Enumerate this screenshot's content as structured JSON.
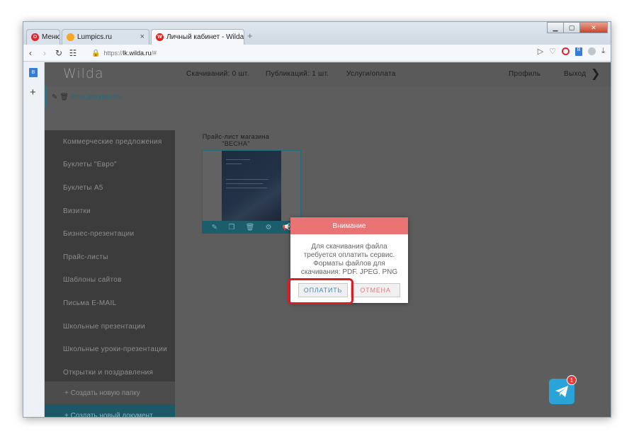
{
  "browser": {
    "tabs": [
      {
        "label": "Меню"
      },
      {
        "label": "Lumpics.ru"
      },
      {
        "label": "Личный кабинет - Wilda"
      }
    ],
    "new_tab_symbol": "+",
    "url": {
      "scheme": "https://",
      "host": "lk.wilda.ru",
      "path": "/#"
    },
    "nav_icons": [
      "back-icon",
      "forward-icon",
      "reload-icon",
      "grid-icon"
    ],
    "window_controls": [
      "minimize-icon",
      "maximize-icon",
      "close-icon"
    ]
  },
  "header": {
    "logo": "Wilda",
    "downloads": "Скачиваний: 0 шт.",
    "publications": "Публикаций: 1 шт.",
    "services": "Услуги/оплата",
    "profile": "Профиль",
    "exit": "Выход"
  },
  "sidebar": {
    "title": "Мои документы",
    "categories": [
      "Коммерческие предложения",
      "Буклеты \"Евро\"",
      "Буклеты А5",
      "Визитки",
      "Бизнес-презентации",
      "Прайс-листы",
      "Шаблоны сайтов",
      "Письма E-MAIL",
      "Школьные презентации",
      "Школьные уроки-презентации",
      "Открытки и поздравления"
    ],
    "new_folder": "+ Создать новую папку",
    "new_document": "+ Создать новый документ"
  },
  "document": {
    "title_line1": "Прайс-лист магазина",
    "title_line2": "\"ВЕСНА\""
  },
  "modal": {
    "title": "Внимание",
    "message": "Для скачивания файла требуется оплатить сервис. Форматы файлов для скачивания: PDF, JPEG, PNG",
    "pay_label": "ОПЛАТИТЬ",
    "cancel_label": "ОТМЕНА"
  },
  "telegram": {
    "badge_count": "1"
  },
  "colors": {
    "modal_header": "#e87474",
    "accent_teal": "#1c5865",
    "highlight": "#d51f25",
    "telegram": "#2aa3d9"
  }
}
